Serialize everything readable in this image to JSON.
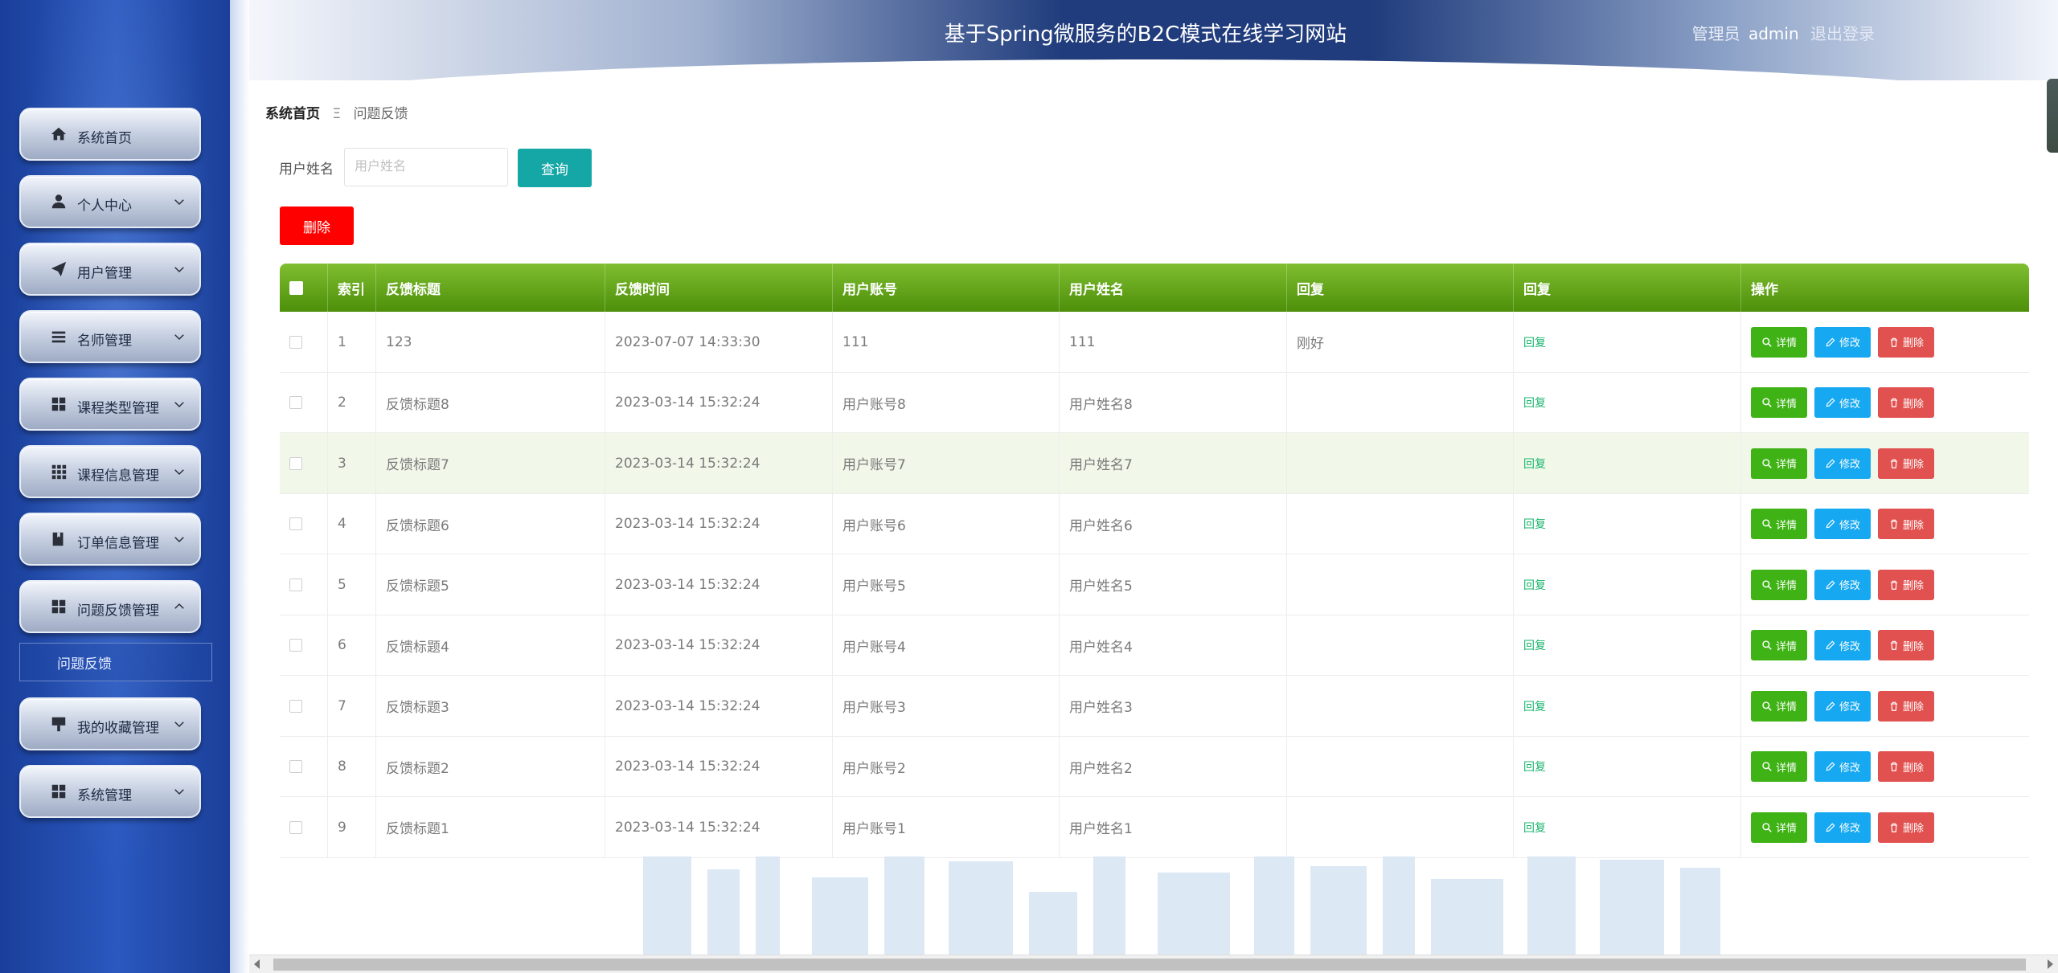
{
  "header": {
    "title": "基于Spring微服务的B2C模式在线学习网站",
    "role": "管理员",
    "username": "admin",
    "logout": "退出登录"
  },
  "sidebar": {
    "items": [
      {
        "label": "系统首页",
        "icon": "home-icon",
        "has_chevron": false
      },
      {
        "label": "个人中心",
        "icon": "user-icon",
        "has_chevron": true
      },
      {
        "label": "用户管理",
        "icon": "send-icon",
        "has_chevron": true
      },
      {
        "label": "名师管理",
        "icon": "list-icon",
        "has_chevron": true
      },
      {
        "label": "课程类型管理",
        "icon": "grid-icon",
        "has_chevron": true
      },
      {
        "label": "课程信息管理",
        "icon": "grid9-icon",
        "has_chevron": true
      },
      {
        "label": "订单信息管理",
        "icon": "book-icon",
        "has_chevron": true
      },
      {
        "label": "问题反馈管理",
        "icon": "grid-icon",
        "has_chevron": true,
        "expanded": true
      },
      {
        "label": "我的收藏管理",
        "icon": "sign-icon",
        "has_chevron": true
      },
      {
        "label": "系统管理",
        "icon": "grid-icon",
        "has_chevron": true
      }
    ],
    "sub_item": "问题反馈"
  },
  "breadcrumb": {
    "home": "系统首页",
    "separator": "Ξ",
    "current": "问题反馈"
  },
  "search": {
    "label": "用户姓名",
    "placeholder": "用户姓名",
    "query_button": "查询"
  },
  "toolbar": {
    "delete_button": "删除"
  },
  "table": {
    "columns": [
      "索引",
      "反馈标题",
      "反馈时间",
      "用户账号",
      "用户姓名",
      "回复",
      "回复",
      "操作"
    ],
    "rows": [
      {
        "index": "1",
        "title": "123",
        "time": "2023-07-07 14:33:30",
        "account": "111",
        "name": "111",
        "reply": "刚好",
        "reply_link": "回复"
      },
      {
        "index": "2",
        "title": "反馈标题8",
        "time": "2023-03-14 15:32:24",
        "account": "用户账号8",
        "name": "用户姓名8",
        "reply": "",
        "reply_link": "回复"
      },
      {
        "index": "3",
        "title": "反馈标题7",
        "time": "2023-03-14 15:32:24",
        "account": "用户账号7",
        "name": "用户姓名7",
        "reply": "",
        "reply_link": "回复"
      },
      {
        "index": "4",
        "title": "反馈标题6",
        "time": "2023-03-14 15:32:24",
        "account": "用户账号6",
        "name": "用户姓名6",
        "reply": "",
        "reply_link": "回复"
      },
      {
        "index": "5",
        "title": "反馈标题5",
        "time": "2023-03-14 15:32:24",
        "account": "用户账号5",
        "name": "用户姓名5",
        "reply": "",
        "reply_link": "回复"
      },
      {
        "index": "6",
        "title": "反馈标题4",
        "time": "2023-03-14 15:32:24",
        "account": "用户账号4",
        "name": "用户姓名4",
        "reply": "",
        "reply_link": "回复"
      },
      {
        "index": "7",
        "title": "反馈标题3",
        "time": "2023-03-14 15:32:24",
        "account": "用户账号3",
        "name": "用户姓名3",
        "reply": "",
        "reply_link": "回复"
      },
      {
        "index": "8",
        "title": "反馈标题2",
        "time": "2023-03-14 15:32:24",
        "account": "用户账号2",
        "name": "用户姓名2",
        "reply": "",
        "reply_link": "回复"
      },
      {
        "index": "9",
        "title": "反馈标题1",
        "time": "2023-03-14 15:32:24",
        "account": "用户账号1",
        "name": "用户姓名1",
        "reply": "",
        "reply_link": "回复"
      }
    ],
    "actions": {
      "detail": "详情",
      "edit": "修改",
      "delete": "删除"
    },
    "highlighted_row": 3
  },
  "colors": {
    "header_green": "#5a9c14",
    "query_teal": "#14a7a6",
    "delete_red": "#ff0000",
    "detail_green": "#3fb216",
    "edit_blue": "#16a8f0",
    "del_red": "#e0514f"
  }
}
